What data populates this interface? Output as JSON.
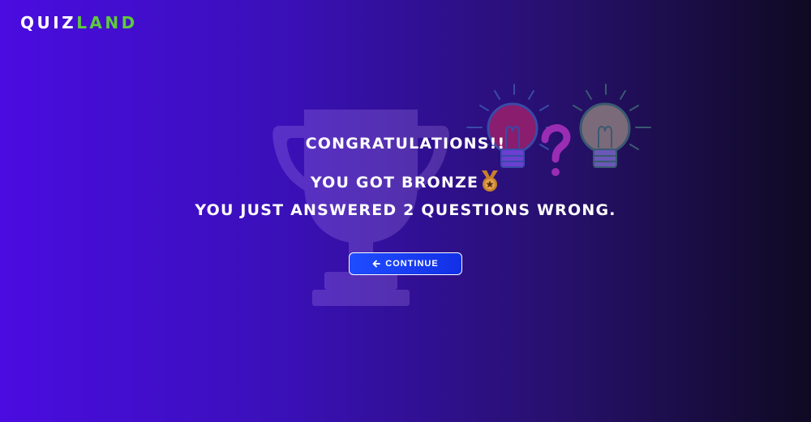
{
  "brand": {
    "part1": "QUIZ",
    "part2": "LAND",
    "colors": {
      "part1": "#ffffff",
      "part2": "#5ecb3c"
    }
  },
  "result": {
    "headline": "CONGRATULATIONS!!",
    "medal_text": "YOU GOT BRONZE",
    "medal_icon": "bronze-medal-icon",
    "detail": "YOU JUST ANSWERED 2 QUESTIONS WRONG."
  },
  "actions": {
    "continue_label": "CONTINUE",
    "continue_icon": "arrow-left-icon"
  },
  "decor": {
    "background_icon": "trophy-icon",
    "illustration_icons": [
      "lightbulb-icon",
      "question-mark-icon",
      "lightbulb-icon"
    ]
  },
  "colors": {
    "background_start": "#4a0ce0",
    "background_end": "#0f0a22",
    "button": "#1f4cff",
    "medal": "#c8812a"
  }
}
